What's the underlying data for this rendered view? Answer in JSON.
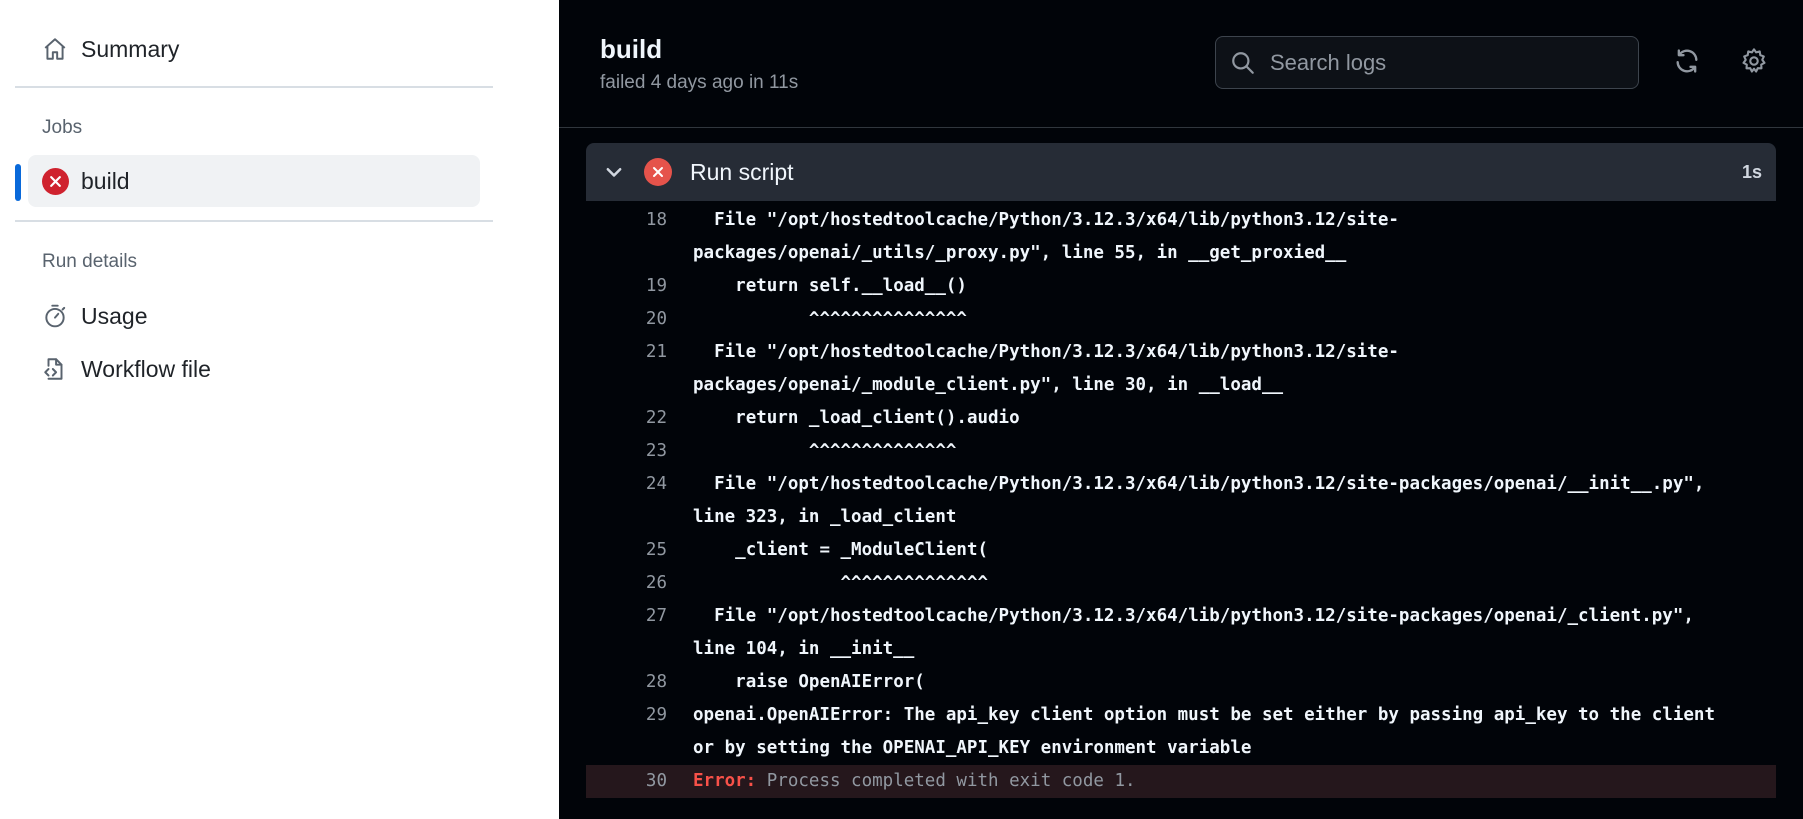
{
  "sidebar": {
    "summary_label": "Summary",
    "jobs_heading": "Jobs",
    "job_label": "build",
    "run_details_heading": "Run details",
    "usage_label": "Usage",
    "workflow_file_label": "Workflow file"
  },
  "header": {
    "title": "build",
    "subtitle": "failed 4 days ago in 11s",
    "search_placeholder": "Search logs"
  },
  "step": {
    "name": "Run script",
    "duration": "1s"
  },
  "log_lines": [
    {
      "n": "18",
      "text": "  File \"/opt/hostedtoolcache/Python/3.12.3/x64/lib/python3.12/site-\npackages/openai/_utils/_proxy.py\", line 55, in __get_proxied__"
    },
    {
      "n": "19",
      "text": "    return self.__load__()"
    },
    {
      "n": "20",
      "text": "           ^^^^^^^^^^^^^^^"
    },
    {
      "n": "21",
      "text": "  File \"/opt/hostedtoolcache/Python/3.12.3/x64/lib/python3.12/site-\npackages/openai/_module_client.py\", line 30, in __load__"
    },
    {
      "n": "22",
      "text": "    return _load_client().audio"
    },
    {
      "n": "23",
      "text": "           ^^^^^^^^^^^^^^"
    },
    {
      "n": "24",
      "text": "  File \"/opt/hostedtoolcache/Python/3.12.3/x64/lib/python3.12/site-packages/openai/__init__.py\",\nline 323, in _load_client"
    },
    {
      "n": "25",
      "text": "    _client = _ModuleClient("
    },
    {
      "n": "26",
      "text": "              ^^^^^^^^^^^^^^"
    },
    {
      "n": "27",
      "text": "  File \"/opt/hostedtoolcache/Python/3.12.3/x64/lib/python3.12/site-packages/openai/_client.py\",\nline 104, in __init__"
    },
    {
      "n": "28",
      "text": "    raise OpenAIError("
    },
    {
      "n": "29",
      "text": "openai.OpenAIError: The api_key client option must be set either by passing api_key to the client\nor by setting the OPENAI_API_KEY environment variable"
    }
  ],
  "error_line": {
    "n": "30",
    "label": "Error:",
    "message": "Process completed with exit code 1."
  },
  "colors": {
    "accent": "#0969da",
    "error": "#cf222e",
    "dark_bg": "#010409"
  },
  "icons": [
    "home-icon",
    "x-circle-icon",
    "stopwatch-icon",
    "file-code-icon",
    "search-icon",
    "sync-icon",
    "gear-icon",
    "chevron-down-icon"
  ]
}
